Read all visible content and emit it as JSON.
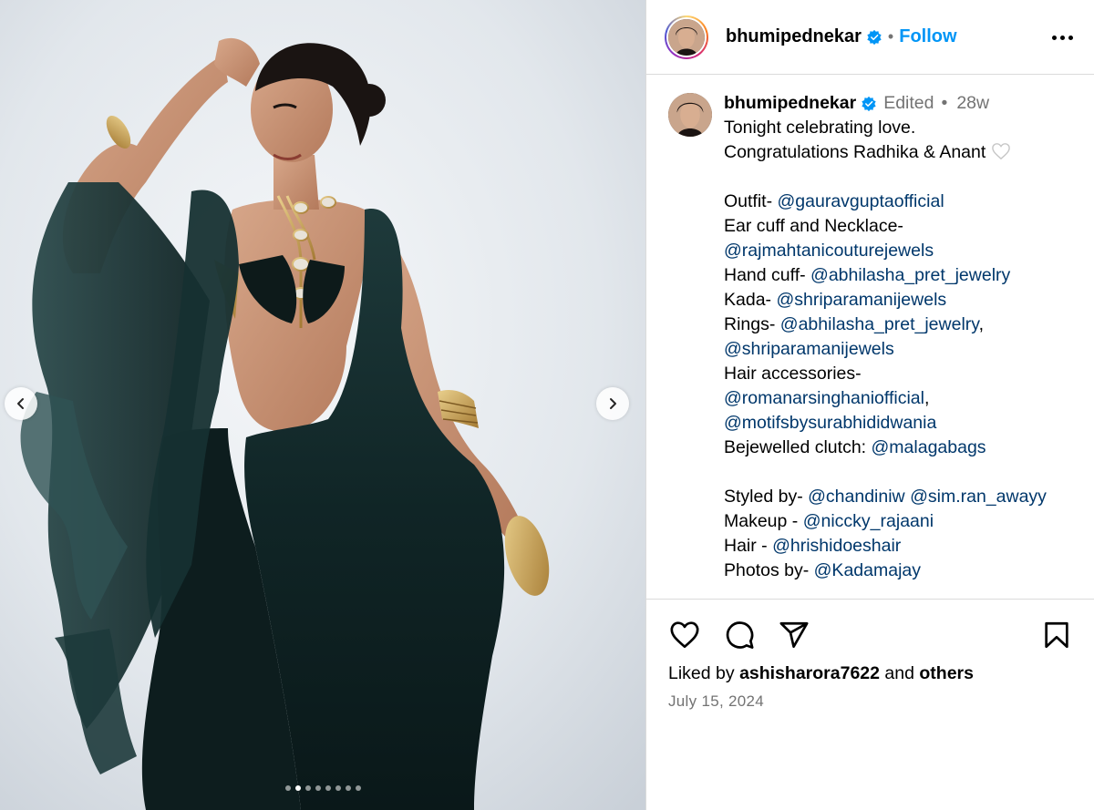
{
  "post": {
    "username": "bhumipednekar",
    "follow_label": "Follow",
    "separator": "•",
    "edited_label": "Edited",
    "age": "28w"
  },
  "caption": {
    "line1": "Tonight celebrating love.",
    "line2": "Congratulations Radhika & Anant",
    "outfit_label": "Outfit- ",
    "outfit_mention": "@gauravguptaofficial",
    "ear_label": "Ear cuff and Necklace-",
    "ear_mention": "@rajmahtanicouturejewels",
    "hand_label": "Hand cuff- ",
    "hand_mention": "@abhilasha_pret_jewelry",
    "kada_label": "Kada- ",
    "kada_mention": "@shriparamanijewels",
    "rings_label": "Rings- ",
    "rings_mention1": "@abhilasha_pret_jewelry",
    "comma": ",",
    "rings_mention2": "@shriparamanijewels",
    "hair_acc_label": "Hair accessories-",
    "hair_acc_mention1": "@romanarsinghaniofficial",
    "hair_acc_mention2": "@motifsbysurabhididwania",
    "clutch_label": "Bejewelled clutch: ",
    "clutch_mention": "@malagabags",
    "styled_label": "Styled by- ",
    "styled_mention1": "@chandiniw",
    "styled_mention2": "@sim.ran_awayy",
    "makeup_label": "Makeup - ",
    "makeup_mention": "@niccky_rajaani",
    "hair_label": "Hair - ",
    "hair_mention": "@hrishidoeshair",
    "photos_label": "Photos by- ",
    "photos_mention": "@Kadamajay"
  },
  "engagement": {
    "liked_by_prefix": "Liked by ",
    "liked_by_user": "ashisharora7622",
    "and_label": " and ",
    "others_label": "others",
    "date": "July 15, 2024"
  },
  "carousel": {
    "total_slides": 8,
    "active_index": 1
  },
  "icons": {
    "like": "heart-icon",
    "comment": "comment-icon",
    "share": "share-icon",
    "save": "bookmark-icon",
    "more": "more-icon",
    "verified": "verified-badge-icon",
    "prev": "chevron-left-icon",
    "next": "chevron-right-icon"
  },
  "colors": {
    "follow": "#0095f6",
    "mention": "#00376b",
    "verified": "#0095f6",
    "meta": "#737373"
  }
}
